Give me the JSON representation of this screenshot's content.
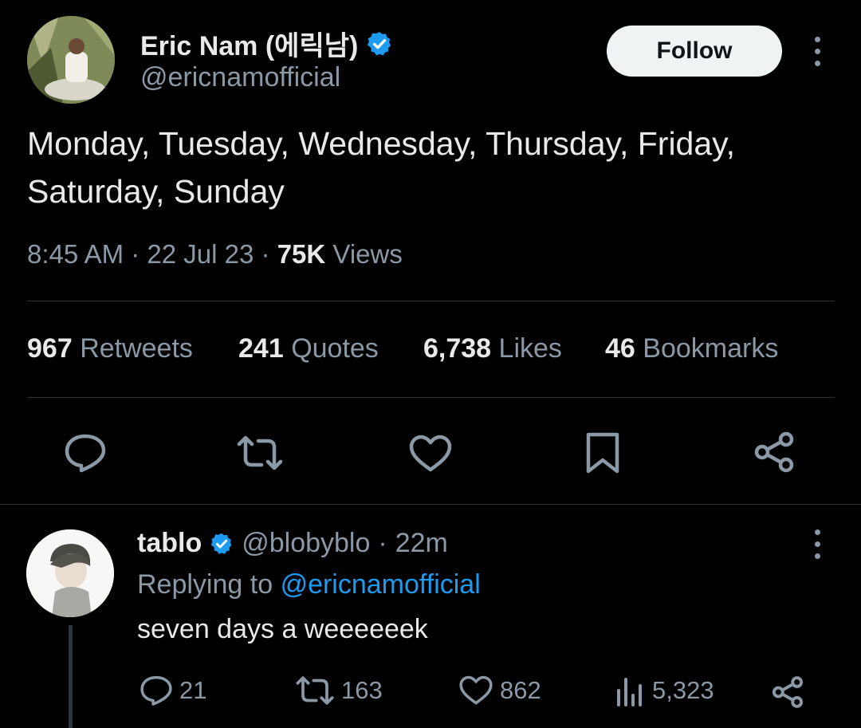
{
  "tweet": {
    "author": {
      "name": "Eric Nam (에릭남)",
      "handle": "@ericnamofficial"
    },
    "follow_label": "Follow",
    "text_line1": "Monday, Tuesday, Wednesday, Thursday, Friday,",
    "text_line2": "Saturday, Sunday",
    "time": "8:45 AM",
    "sep1": "·",
    "date": "22 Jul 23",
    "sep2": "·",
    "views_count": "75K",
    "views_label": "Views"
  },
  "stats": [
    {
      "count": "967",
      "label": "Retweets"
    },
    {
      "count": "241",
      "label": "Quotes"
    },
    {
      "count": "6,738",
      "label": "Likes"
    },
    {
      "count": "46",
      "label": "Bookmarks"
    }
  ],
  "actions": [
    "reply-icon",
    "retweet-icon",
    "like-icon",
    "bookmark-icon",
    "share-icon"
  ],
  "reply": {
    "name": "tablo",
    "handle": "@blobyblo",
    "sep": "·",
    "time": "22m",
    "replying_prefix": "Replying to",
    "replying_to": "@ericnamofficial",
    "text": "seven days a weeeeeek",
    "replies": "21",
    "retweets": "163",
    "likes": "862",
    "views": "5,323"
  },
  "colors": {
    "background": "#000000",
    "text": "#e7e9ea",
    "secondary": "#8b98a5",
    "accent": "#1d9bf0",
    "divider": "#2f3336"
  }
}
